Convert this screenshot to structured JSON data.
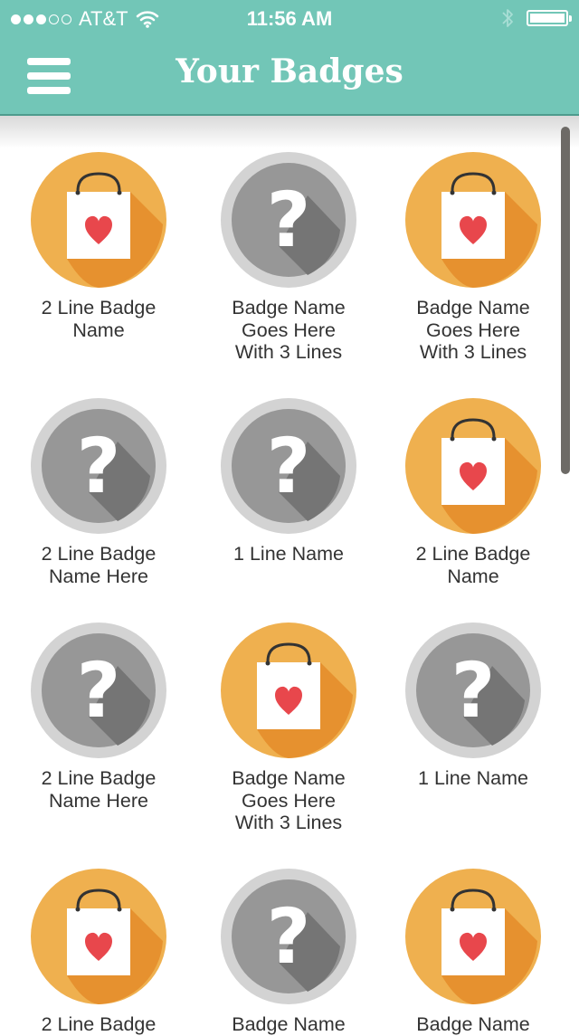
{
  "status_bar": {
    "carrier": "AT&T",
    "time": "11:56 AM",
    "signal_bars": 3,
    "signal_total": 5
  },
  "header": {
    "title": "Your Badges"
  },
  "colors": {
    "teal": "#72c6b7",
    "orange_light": "#efb04f",
    "orange_dark": "#e6912f",
    "gray_ring": "#d3d3d3",
    "gray_inner": "#979797",
    "gray_shadow": "#757575",
    "heart": "#e8474c",
    "label_text": "#333333"
  },
  "badges": [
    {
      "type": "unlocked",
      "icon": "shopping-bag-heart-icon",
      "lines": [
        "2 Line Badge",
        "Name"
      ]
    },
    {
      "type": "locked",
      "icon": "question-mark-icon",
      "lines": [
        "Badge Name",
        "Goes Here",
        "With 3 Lines"
      ]
    },
    {
      "type": "unlocked",
      "icon": "shopping-bag-heart-icon",
      "lines": [
        "Badge Name",
        "Goes Here",
        "With 3 Lines"
      ]
    },
    {
      "type": "locked",
      "icon": "question-mark-icon",
      "lines": [
        "2 Line Badge",
        "Name Here"
      ]
    },
    {
      "type": "locked",
      "icon": "question-mark-icon",
      "lines": [
        "1 Line Name"
      ]
    },
    {
      "type": "unlocked",
      "icon": "shopping-bag-heart-icon",
      "lines": [
        "2 Line Badge",
        "Name"
      ]
    },
    {
      "type": "locked",
      "icon": "question-mark-icon",
      "lines": [
        "2 Line Badge",
        "Name Here"
      ]
    },
    {
      "type": "unlocked",
      "icon": "shopping-bag-heart-icon",
      "lines": [
        "Badge Name",
        "Goes Here",
        "With 3 Lines"
      ]
    },
    {
      "type": "locked",
      "icon": "question-mark-icon",
      "lines": [
        "1 Line Name"
      ]
    },
    {
      "type": "unlocked",
      "icon": "shopping-bag-heart-icon",
      "lines": [
        "2 Line Badge"
      ]
    },
    {
      "type": "locked",
      "icon": "question-mark-icon",
      "lines": [
        "Badge Name"
      ]
    },
    {
      "type": "unlocked",
      "icon": "shopping-bag-heart-icon",
      "lines": [
        "Badge Name"
      ]
    }
  ]
}
